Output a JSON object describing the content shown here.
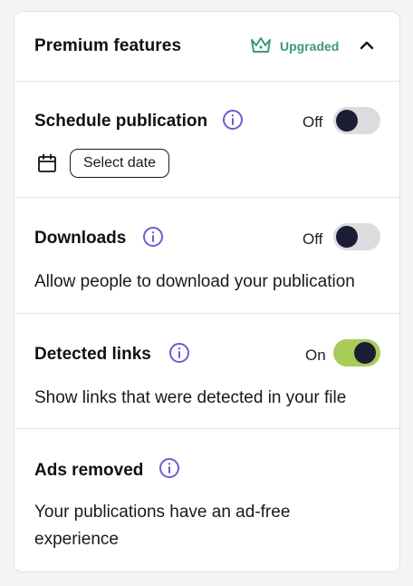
{
  "colors": {
    "accent_green": "#3d9a74",
    "info_purple": "#6b5ed1",
    "toggle_on": "#a7cc57",
    "toggle_off": "#dcdcde",
    "knob": "#1d1c35"
  },
  "header": {
    "title": "Premium features",
    "badge_icon": "crown-icon",
    "badge_label": "Upgraded",
    "collapse_icon": "chevron-up-icon"
  },
  "sections": [
    {
      "title": "Schedule publication",
      "info_icon": "info-icon",
      "toggle": {
        "state_label": "Off",
        "on": false
      },
      "date_icon": "calendar-icon",
      "date_button_label": "Select date"
    },
    {
      "title": "Downloads",
      "info_icon": "info-icon",
      "toggle": {
        "state_label": "Off",
        "on": false
      },
      "description": "Allow people to download your publication"
    },
    {
      "title": "Detected links",
      "info_icon": "info-icon",
      "toggle": {
        "state_label": "On",
        "on": true
      },
      "description": "Show links that were detected in your file"
    },
    {
      "title": "Ads removed",
      "info_icon": "info-icon",
      "description": "Your publications have an ad-free experience"
    }
  ]
}
